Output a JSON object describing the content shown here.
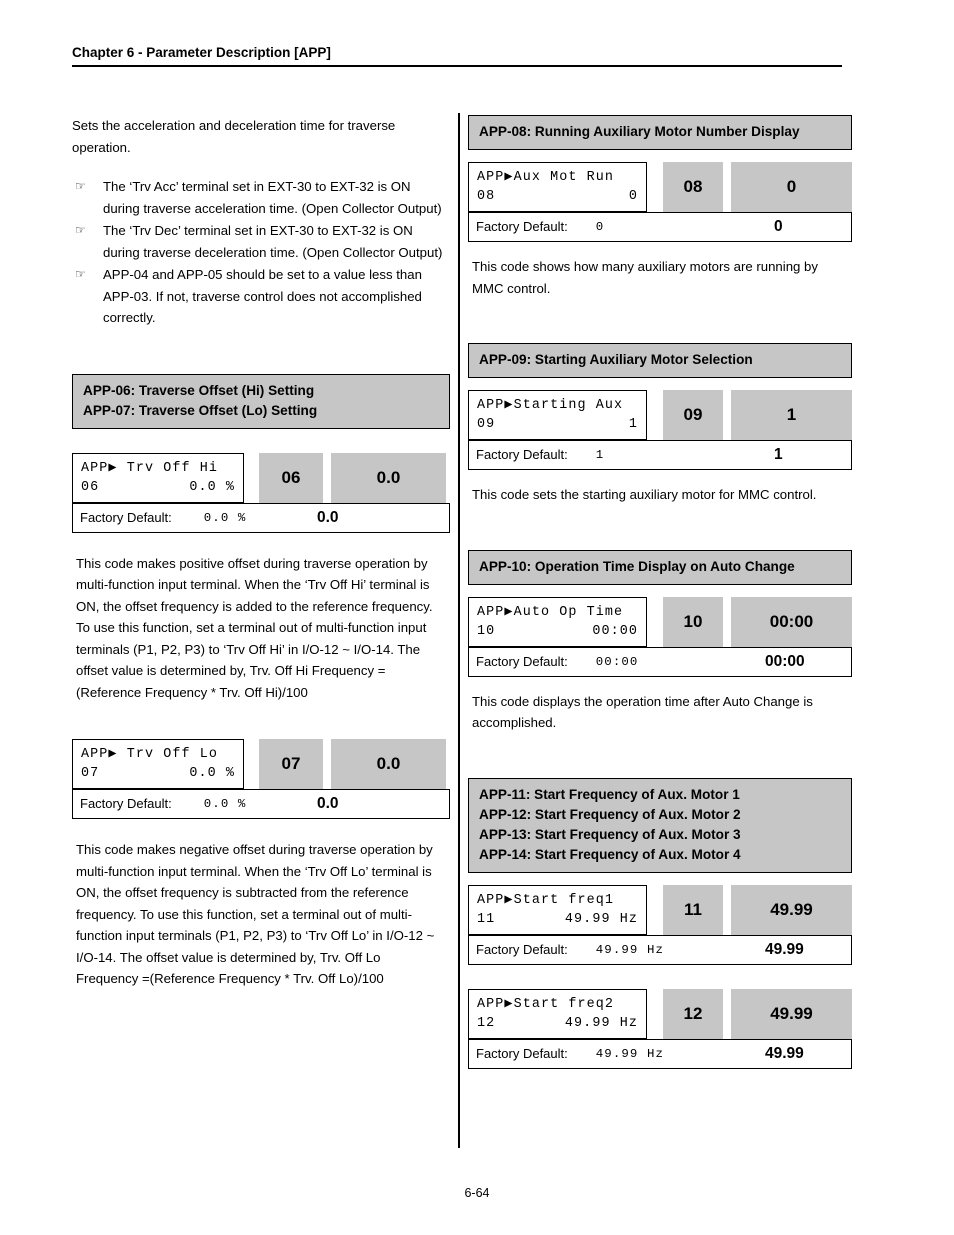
{
  "header": {
    "chapter_title": "Chapter 6 - Parameter Description [APP]"
  },
  "footer": {
    "page_number": "6-64"
  },
  "icons": {
    "hand_pointer": "☞",
    "lcd_arrow": "▶"
  },
  "colors": {
    "gray_fill": "#c6c6c6",
    "border": "#000000",
    "page_background": "#ffffff"
  },
  "left_column": {
    "intro_paragraph": "Sets the acceleration and deceleration time for traverse operation.",
    "notes": [
      "The ‘Trv Acc’ terminal set in EXT-30 to EXT-32 is ON during traverse acceleration time. (Open Collector Output)",
      "The ‘Trv Dec’ terminal set in EXT-30 to EXT-32 is ON during traverse deceleration time. (Open Collector Output)",
      "APP-04 and APP-05 should be set to a value less than APP-03. If not, traverse control does not accomplished correctly."
    ],
    "section_header": {
      "line1": "APP-06: Traverse Offset (Hi) Setting",
      "line2": "APP-07: Traverse Offset (Lo) Setting"
    },
    "param_06": {
      "lcd_line1": "APP▶ Trv Off Hi",
      "lcd_line2_left": "06",
      "lcd_line2_right": "0.0 %",
      "chip_code": "06",
      "chip_value": "0.0",
      "factory_label": "Factory Default:",
      "factory_value_mono": "0.0 %",
      "factory_value_bold": "0.0"
    },
    "desc_06": "This code makes positive offset during traverse operation by multi-function input terminal. When the ‘Trv Off Hi’ terminal is ON, the offset frequency is added to the reference frequency. To use this function, set a terminal out of multi-function input terminals (P1, P2, P3) to ‘Trv Off Hi’ in I/O-12 ~ I/O-14. The offset value is determined by, Trv. Off Hi Frequency =(Reference Frequency * Trv. Off Hi)/100",
    "param_07": {
      "lcd_line1": "APP▶ Trv Off Lo",
      "lcd_line2_left": "07",
      "lcd_line2_right": "0.0 %",
      "chip_code": "07",
      "chip_value": "0.0",
      "factory_label": "Factory Default:",
      "factory_value_mono": "0.0 %",
      "factory_value_bold": "0.0"
    },
    "desc_07": "This code makes negative offset during traverse operation by multi-function input terminal. When the ‘Trv Off Lo’ terminal is ON, the offset frequency is subtracted from the reference frequency. To use this function, set a terminal out of multi-function input terminals (P1, P2, P3) to ‘Trv Off Lo’ in I/O-12 ~ I/O-14. The offset value is determined by, Trv. Off Lo Frequency =(Reference Frequency * Trv. Off Lo)/100"
  },
  "right_column": {
    "section_08": {
      "header": "APP-08: Running Auxiliary Motor Number Display",
      "lcd_line1": "APP▶Aux Mot Run",
      "lcd_line2_left": "08",
      "lcd_line2_right": "0",
      "chip_code": "08",
      "chip_value": "0",
      "factory_label": "Factory Default:",
      "factory_value_mono": "0",
      "factory_value_bold": "0",
      "description": "This code shows how many auxiliary motors are running by MMC control."
    },
    "section_09": {
      "header": "APP-09: Starting Auxiliary Motor Selection",
      "lcd_line1": "APP▶Starting Aux",
      "lcd_line2_left": "09",
      "lcd_line2_right": "1",
      "chip_code": "09",
      "chip_value": "1",
      "factory_label": "Factory Default:",
      "factory_value_mono": "1",
      "factory_value_bold": "1",
      "description": "This code sets the starting auxiliary motor for MMC control."
    },
    "section_10": {
      "header": "APP-10: Operation Time Display on Auto Change",
      "lcd_line1": "APP▶Auto Op Time",
      "lcd_line2_left": "10",
      "lcd_line2_right": "00:00",
      "chip_code": "10",
      "chip_value": "00:00",
      "factory_label": "Factory Default:",
      "factory_value_mono": "00:00",
      "factory_value_bold": "00:00",
      "description": "This code displays the operation time after Auto Change is accomplished."
    },
    "section_11_14": {
      "header_line1": "APP-11: Start Frequency of Aux. Motor 1",
      "header_line2": "APP-12: Start Frequency of Aux. Motor 2",
      "header_line3": "APP-13: Start Frequency of Aux. Motor 3",
      "header_line4": "APP-14: Start Frequency of Aux. Motor 4",
      "param_11": {
        "lcd_line1": "APP▶Start freq1",
        "lcd_line2_left": "11",
        "lcd_line2_right": "49.99 Hz",
        "chip_code": "11",
        "chip_value": "49.99",
        "factory_label": "Factory Default:",
        "factory_value_mono": "49.99 Hz",
        "factory_value_bold": "49.99"
      },
      "param_12": {
        "lcd_line1": "APP▶Start freq2",
        "lcd_line2_left": "12",
        "lcd_line2_right": "49.99 Hz",
        "chip_code": "12",
        "chip_value": "49.99",
        "factory_label": "Factory Default:",
        "factory_value_mono": "49.99 Hz",
        "factory_value_bold": "49.99"
      }
    }
  }
}
